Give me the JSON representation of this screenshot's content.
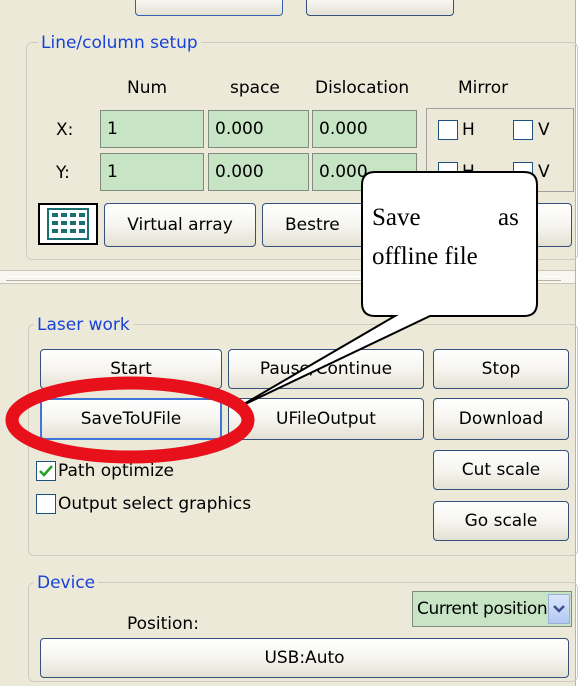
{
  "line_column_setup": {
    "title": "Line/column setup",
    "headers": {
      "num": "Num",
      "space": "space",
      "dislocation": "Dislocation",
      "mirror": "Mirror"
    },
    "rows": [
      {
        "label": "X:",
        "num": "1",
        "space": "0.000",
        "dislocation": "0.000",
        "h": "H",
        "v": "V"
      },
      {
        "label": "Y:",
        "num": "1",
        "space": "0.000",
        "dislocation": "0.000",
        "h": "H",
        "v": "V"
      }
    ],
    "virtual_array": "Virtual array",
    "bestrew": "Bestre"
  },
  "callout": {
    "line1_left": "Save",
    "line1_right": "as",
    "line2": "offline file"
  },
  "laser_work": {
    "title": "Laser work",
    "start": "Start",
    "pause": "Pause/Continue",
    "stop": "Stop",
    "save_to_ufile": "SaveToUFile",
    "ufile_output": "UFileOutput",
    "download": "Download",
    "path_optimize": "Path optimize",
    "path_optimize_checked": true,
    "output_select": "Output select graphics",
    "output_select_checked": false,
    "cut_scale": "Cut scale",
    "go_scale": "Go scale"
  },
  "device": {
    "title": "Device",
    "position_label": "Position:",
    "position_value": "Current position",
    "usb": "USB:Auto"
  },
  "colors": {
    "highlight": "#e8101a",
    "legend": "#1742d8",
    "field": "#c7e5c5"
  }
}
